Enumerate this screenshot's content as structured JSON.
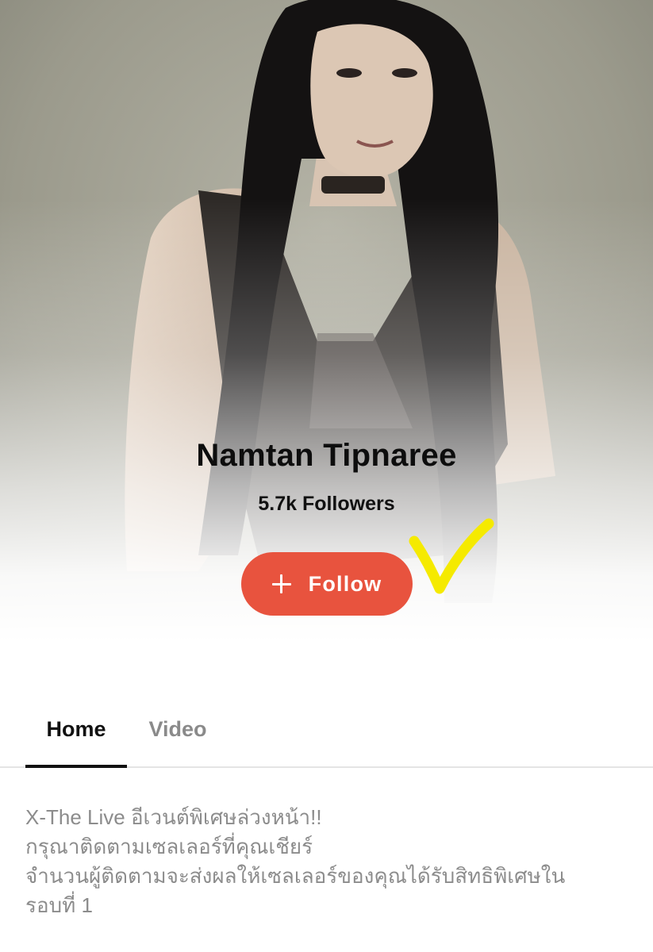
{
  "profile": {
    "name": "Namtan Tipnaree",
    "followers": "5.7k Followers",
    "cover_photo_icon": "profile-cover-image"
  },
  "follow_button": {
    "label": "Follow",
    "icon": "plus-icon",
    "color": "#e8533e"
  },
  "annotation": {
    "icon": "checkmark-icon",
    "color": "#f5ea00"
  },
  "tabs": [
    {
      "label": "Home",
      "active": true
    },
    {
      "label": "Video",
      "active": false
    }
  ],
  "announcement": {
    "lines": [
      "X-The Live อีเวนต์พิเศษล่วงหน้า!!",
      "กรุณาติดตามเซลเลอร์ที่คุณเชียร์",
      "จำนวนผู้ติดตามจะส่งผลให้เซลเลอร์ของคุณได้รับสิทธิพิเศษใน",
      "รอบที่ 1"
    ]
  },
  "colors": {
    "accent": "#e8533e",
    "text_primary": "#111111",
    "text_muted": "#8c8c8c"
  }
}
